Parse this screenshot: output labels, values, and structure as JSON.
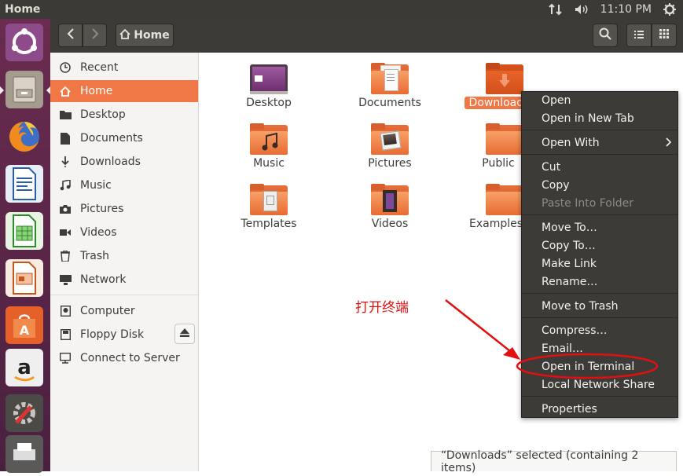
{
  "topbar": {
    "title": "Home",
    "time": "11:10 PM"
  },
  "header": {
    "path_label": "Home"
  },
  "sidebar": {
    "items": [
      {
        "label": "Recent"
      },
      {
        "label": "Home"
      },
      {
        "label": "Desktop"
      },
      {
        "label": "Documents"
      },
      {
        "label": "Downloads"
      },
      {
        "label": "Music"
      },
      {
        "label": "Pictures"
      },
      {
        "label": "Videos"
      },
      {
        "label": "Trash"
      },
      {
        "label": "Network"
      },
      {
        "label": "Computer"
      },
      {
        "label": "Floppy Disk"
      },
      {
        "label": "Connect to Server"
      }
    ]
  },
  "files": [
    {
      "label": "Desktop"
    },
    {
      "label": "Documents"
    },
    {
      "label": "Downloads"
    },
    {
      "label": "Music"
    },
    {
      "label": "Pictures"
    },
    {
      "label": "Public"
    },
    {
      "label": "Templates"
    },
    {
      "label": "Videos"
    },
    {
      "label": "Examples"
    }
  ],
  "context_menu": {
    "items": [
      {
        "label": "Open"
      },
      {
        "label": "Open in New Tab"
      },
      {
        "label": "Open With"
      },
      {
        "label": "Cut"
      },
      {
        "label": "Copy"
      },
      {
        "label": "Paste Into Folder"
      },
      {
        "label": "Move To…"
      },
      {
        "label": "Copy To…"
      },
      {
        "label": "Make Link"
      },
      {
        "label": "Rename…"
      },
      {
        "label": "Move to Trash"
      },
      {
        "label": "Compress…"
      },
      {
        "label": "Email…"
      },
      {
        "label": "Open in Terminal"
      },
      {
        "label": "Local Network Share"
      },
      {
        "label": "Properties"
      }
    ]
  },
  "annotation": {
    "text": "打开终端",
    "color": "#e01010"
  },
  "status": {
    "text": "“Downloads” selected  (containing 2 items)"
  },
  "colors": {
    "accent": "#f07746",
    "launcher": "#5a2547",
    "menu_bg": "#3c3b37"
  }
}
